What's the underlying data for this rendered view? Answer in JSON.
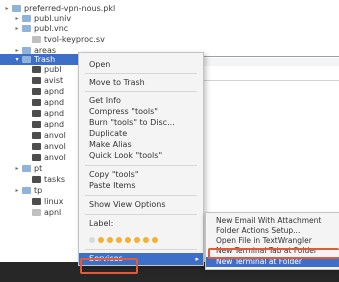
{
  "tree": [
    {
      "name": "preferred-vpn-nous.pkl",
      "indent": 0,
      "icon": "folder",
      "disclosure": "▸"
    },
    {
      "name": "publ.univ",
      "indent": 1,
      "icon": "folder",
      "disclosure": "▸"
    },
    {
      "name": "publ.vnc",
      "indent": 1,
      "icon": "folder",
      "disclosure": "▸"
    },
    {
      "name": "tvol-keyproc.sv",
      "indent": 2,
      "icon": "file-doc",
      "disclosure": ""
    },
    {
      "name": "areas",
      "indent": 1,
      "icon": "folder",
      "disclosure": "▸"
    },
    {
      "name": "Trash",
      "indent": 1,
      "icon": "folder",
      "disclosure": "▾",
      "selected": true
    },
    {
      "name": "publ",
      "indent": 2,
      "icon": "file-dark",
      "disclosure": ""
    },
    {
      "name": "avist",
      "indent": 2,
      "icon": "file-dark",
      "disclosure": ""
    },
    {
      "name": "apnd",
      "indent": 2,
      "icon": "file-dark",
      "disclosure": ""
    },
    {
      "name": "apnd",
      "indent": 2,
      "icon": "file-dark",
      "disclosure": ""
    },
    {
      "name": "apnd",
      "indent": 2,
      "icon": "file-dark",
      "disclosure": ""
    },
    {
      "name": "apnd",
      "indent": 2,
      "icon": "file-dark",
      "disclosure": ""
    },
    {
      "name": "anvol",
      "indent": 2,
      "icon": "file-dark",
      "disclosure": ""
    },
    {
      "name": "anvol",
      "indent": 2,
      "icon": "file-dark",
      "disclosure": ""
    },
    {
      "name": "anvol",
      "indent": 2,
      "icon": "file-dark",
      "disclosure": ""
    },
    {
      "name": "pt",
      "indent": 1,
      "icon": "folder",
      "disclosure": "▸"
    },
    {
      "name": "tasks",
      "indent": 2,
      "icon": "file-dark",
      "disclosure": ""
    },
    {
      "name": "tp",
      "indent": 1,
      "icon": "folder",
      "disclosure": "▸"
    },
    {
      "name": "linux",
      "indent": 2,
      "icon": "file-dark",
      "disclosure": ""
    },
    {
      "name": "apnl",
      "indent": 2,
      "icon": "file-doc",
      "disclosure": ""
    }
  ],
  "menu": {
    "group1": [
      "Open"
    ],
    "group2": [
      "Move to Trash"
    ],
    "group3": [
      "Get Info",
      "Compress \"tools\"",
      "Burn \"tools\" to Disc...",
      "Duplicate",
      "Make Alias",
      "Quick Look \"tools\""
    ],
    "group4": [
      "Copy \"tools\"",
      "Paste Items"
    ],
    "group5": [
      "Show View Options"
    ],
    "label_title": "Label:",
    "label_colors": [
      "#d9d9d9",
      "#f2b134",
      "#f2b134",
      "#f2b134",
      "#f2b134",
      "#f2b134",
      "#f2b134",
      "#f2b134"
    ],
    "services": "Services",
    "services_arrow": "▸"
  },
  "submenu": {
    "items": [
      "New Email With Attachment",
      "Folder Actions Setup...",
      "Open File in TextWrangler",
      "New Terminal Tab at Folder",
      "New Terminal at Folder"
    ],
    "highlighted_index": 4
  },
  "colors": {
    "selection": "#3d6fc9",
    "annotation": "#e05b3c"
  }
}
